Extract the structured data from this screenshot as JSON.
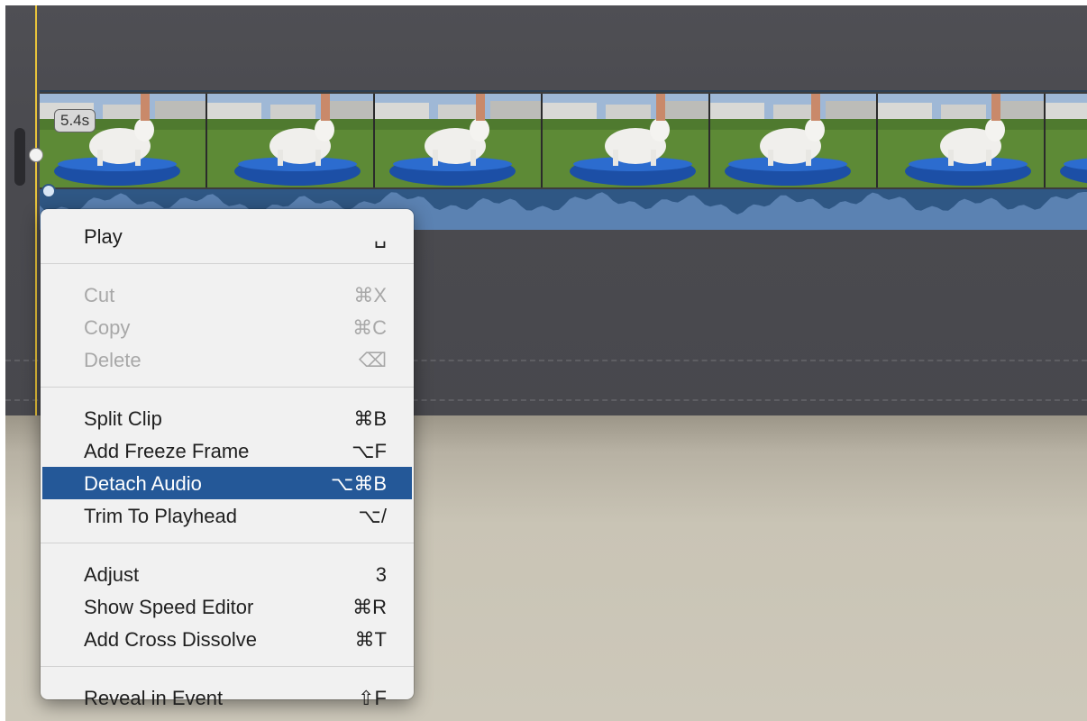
{
  "timeline": {
    "clip": {
      "duration": "5.4s",
      "frame_count": 7
    },
    "colors": {
      "timeline_bg": "#4b4b50",
      "playhead": "#e8c33b",
      "audio_track": "#4d76a8",
      "menu_highlight": "#245898"
    }
  },
  "context_menu": {
    "groups": [
      [
        {
          "label": "Play",
          "shortcut": "␣",
          "enabled": true
        }
      ],
      [
        {
          "label": "Cut",
          "shortcut": "⌘X",
          "enabled": false
        },
        {
          "label": "Copy",
          "shortcut": "⌘C",
          "enabled": false
        },
        {
          "label": "Delete",
          "shortcut": "⌫",
          "enabled": false
        }
      ],
      [
        {
          "label": "Split Clip",
          "shortcut": "⌘B",
          "enabled": true
        },
        {
          "label": "Add Freeze Frame",
          "shortcut": "⌥F",
          "enabled": true
        },
        {
          "label": "Detach Audio",
          "shortcut": "⌥⌘B",
          "enabled": true,
          "selected": true
        },
        {
          "label": "Trim To Playhead",
          "shortcut": "⌥/",
          "enabled": true
        }
      ],
      [
        {
          "label": "Adjust",
          "shortcut": "3",
          "enabled": true
        },
        {
          "label": "Show Speed Editor",
          "shortcut": "⌘R",
          "enabled": true
        },
        {
          "label": "Add Cross Dissolve",
          "shortcut": "⌘T",
          "enabled": true
        }
      ],
      [
        {
          "label": "Reveal in Event",
          "shortcut": "⇧F",
          "enabled": true
        }
      ]
    ]
  }
}
